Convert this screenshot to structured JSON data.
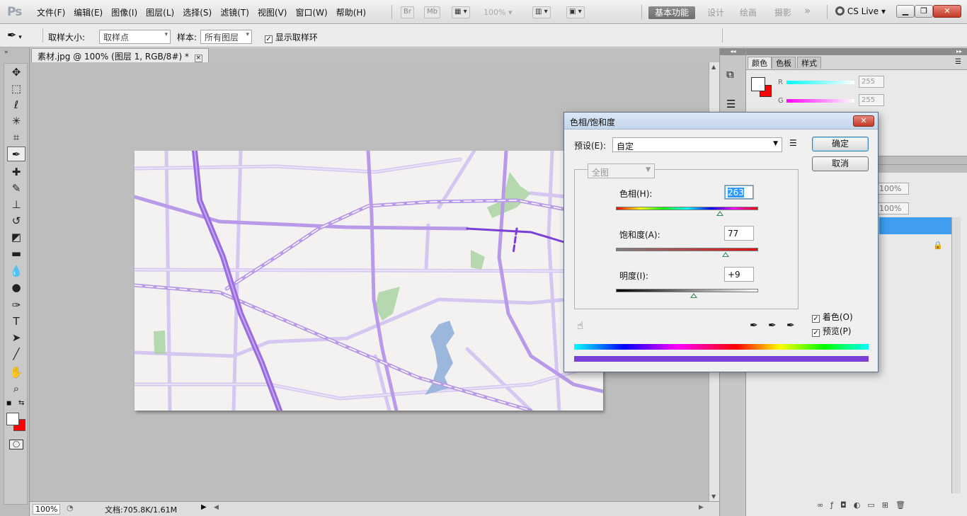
{
  "app": {
    "logo": "Ps"
  },
  "menu": [
    "文件(F)",
    "编辑(E)",
    "图像(I)",
    "图层(L)",
    "选择(S)",
    "滤镜(T)",
    "视图(V)",
    "窗口(W)",
    "帮助(H)"
  ],
  "menubar": {
    "br_label": "Br",
    "mb_label": "Mb",
    "zoom": "100%",
    "workspaces": [
      "基本功能",
      "设计",
      "绘画",
      "摄影"
    ],
    "more_glyph": "»",
    "cslive": "CS Live"
  },
  "options": {
    "sample_size_label": "取样大小:",
    "sample_size_value": "取样点",
    "sample_label": "样本:",
    "sample_value": "所有图层",
    "show_ring_label": "显示取样环",
    "show_ring_checked": true
  },
  "document": {
    "tab_title": "素材.jpg @ 100% (图层 1, RGB/8#) *",
    "close_glyph": "×"
  },
  "status": {
    "zoom": "100%",
    "doc_info": "文档:705.8K/1.61M"
  },
  "panels": {
    "tabs": [
      "颜色",
      "色板",
      "样式"
    ],
    "color": {
      "r_label": "R",
      "g_label": "G",
      "r_value": "255",
      "g_value": "255"
    },
    "opacity_value": "100%",
    "fill_value": "100%"
  },
  "dialog": {
    "title": "色相/饱和度",
    "close_glyph": "✕",
    "preset_label": "预设(E):",
    "preset_value": "自定",
    "channel_value": "全图",
    "hue_label": "色相(H):",
    "hue_value": "263",
    "hue_level": 0.73,
    "saturation_label": "饱和度(A):",
    "saturation_value": "77",
    "saturation_level": 0.77,
    "lightness_label": "明度(I):",
    "lightness_value": "+9",
    "lightness_level": 0.545,
    "ok_label": "确定",
    "cancel_label": "取消",
    "colorize_label": "着色(O)",
    "colorize_checked": true,
    "preview_label": "预览(P)",
    "preview_checked": true
  },
  "colors": {
    "accent_purple": "#7b3fd6",
    "map_road_purple": "#9b6be0",
    "dialog_result_bar": "#7b3fd6",
    "foreground": "#ffffff",
    "background": "#ff0000"
  }
}
